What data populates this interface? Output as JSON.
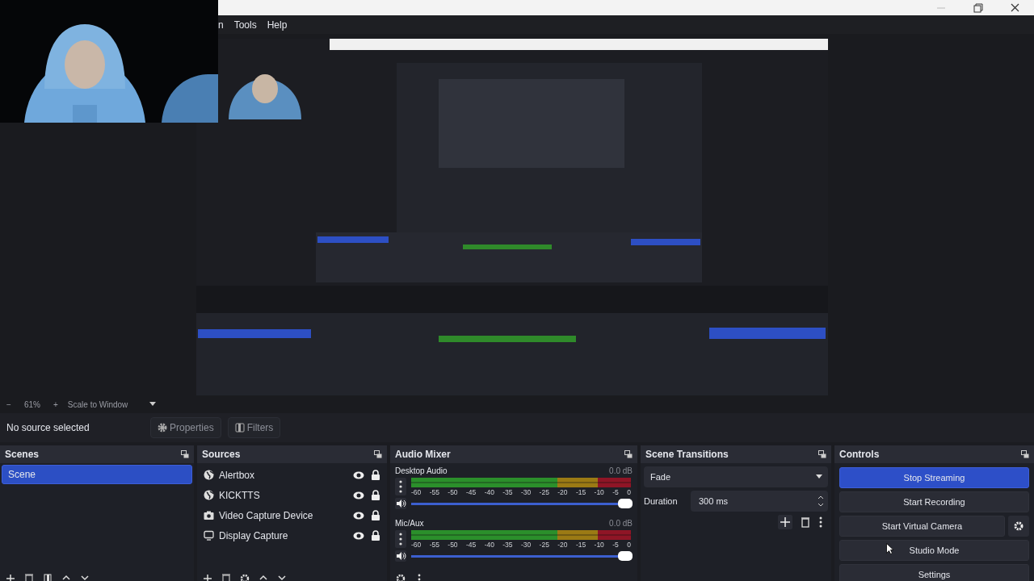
{
  "window": {
    "menu": [
      "n",
      "Tools",
      "Help"
    ]
  },
  "preview": {
    "zoom_out": "−",
    "zoom": "61%",
    "zoom_in": "+",
    "scale_mode": "Scale to Window"
  },
  "source_bar": {
    "status": "No source selected",
    "buttons": [
      {
        "label": "Properties",
        "kind": "gear"
      },
      {
        "label": "Filters",
        "kind": "filter"
      }
    ]
  },
  "scenes": {
    "title": "Scenes",
    "items": [
      {
        "label": "Scene",
        "selected": true
      }
    ]
  },
  "sources": {
    "title": "Sources",
    "items": [
      {
        "label": "Alertbox",
        "kind": "browser",
        "visible": true,
        "locked": true
      },
      {
        "label": "KICKTTS",
        "kind": "browser",
        "visible": true,
        "locked": true
      },
      {
        "label": "Video Capture Device",
        "kind": "camera",
        "visible": true,
        "locked": true
      },
      {
        "label": "Display Capture",
        "kind": "display",
        "visible": true,
        "locked": true
      }
    ]
  },
  "audio_mixer": {
    "title": "Audio Mixer",
    "channels": [
      {
        "name": "Desktop Audio",
        "reading": "0.0 dB",
        "level": 1,
        "ticks": [
          "-60",
          "-55",
          "-50",
          "-45",
          "-40",
          "-35",
          "-30",
          "-25",
          "-20",
          "-15",
          "-10",
          "-5",
          "0"
        ]
      },
      {
        "name": "Mic/Aux",
        "reading": "0.0 dB",
        "level": 1,
        "ticks": [
          "-60",
          "-55",
          "-50",
          "-45",
          "-40",
          "-35",
          "-30",
          "-25",
          "-20",
          "-15",
          "-10",
          "-5",
          "0"
        ]
      }
    ]
  },
  "scene_transitions": {
    "title": "Scene Transitions",
    "transition": "Fade",
    "duration_label": "Duration",
    "duration": "300 ms"
  },
  "controls": {
    "title": "Controls",
    "buttons": [
      {
        "label": "Stop Streaming",
        "active": true
      },
      {
        "label": "Start Recording",
        "active": false
      },
      {
        "label": "Start Virtual Camera",
        "active": false,
        "kind": "with_settings"
      },
      {
        "label": "Studio Mode",
        "active": false
      },
      {
        "label": "Settings",
        "active": false
      }
    ]
  }
}
